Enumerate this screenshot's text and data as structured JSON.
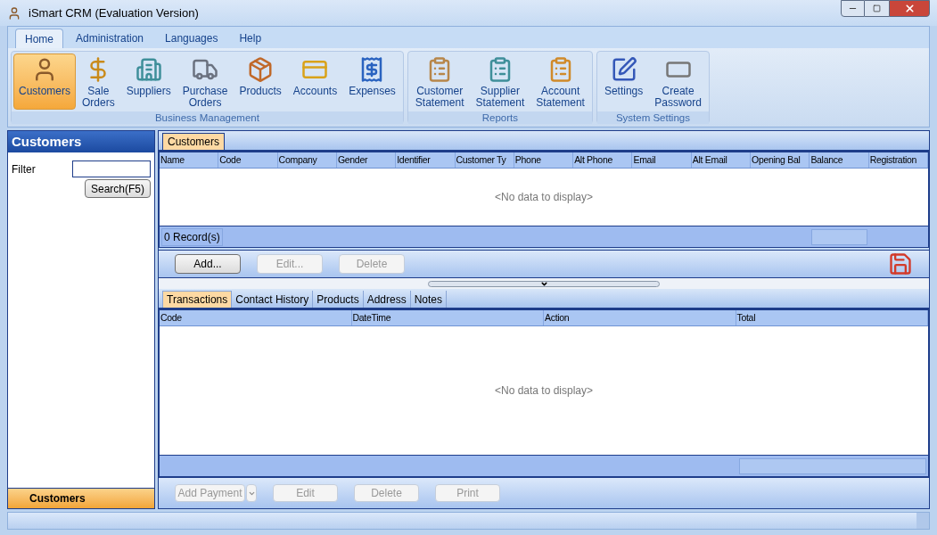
{
  "window": {
    "title": "iSmart CRM (Evaluation Version)"
  },
  "ribbon_tabs": [
    {
      "label": "Home",
      "selected": true
    },
    {
      "label": "Administration",
      "selected": false
    },
    {
      "label": "Languages",
      "selected": false
    },
    {
      "label": "Help",
      "selected": false
    }
  ],
  "ribbon_groups": [
    {
      "label": "Business Management",
      "items": [
        {
          "label": "Customers",
          "selected": true
        },
        {
          "label": "Sale Orders",
          "selected": false
        },
        {
          "label": "Suppliers",
          "selected": false
        },
        {
          "label": "Purchase Orders",
          "selected": false
        },
        {
          "label": "Products",
          "selected": false
        },
        {
          "label": "Accounts",
          "selected": false
        },
        {
          "label": "Expenses",
          "selected": false
        }
      ]
    },
    {
      "label": "Reports",
      "items": [
        {
          "label": "Customer Statement",
          "selected": false
        },
        {
          "label": "Supplier Statement",
          "selected": false
        },
        {
          "label": "Account Statement",
          "selected": false
        }
      ]
    },
    {
      "label": "System Settings",
      "items": [
        {
          "label": "Settings",
          "selected": false
        },
        {
          "label": "Create Password",
          "selected": false
        }
      ]
    }
  ],
  "sidebar": {
    "title": "Customers",
    "filter_label": "Filter",
    "search_button": "Search(F5)",
    "nav": [
      {
        "label": "Customers",
        "selected": true
      }
    ]
  },
  "top_tabs": [
    {
      "label": "Customers",
      "selected": true
    }
  ],
  "customers_table": {
    "columns": [
      "Name",
      "Code",
      "Company",
      "Gender",
      "Identifier",
      "Customer Ty",
      "Phone",
      "Alt Phone",
      "Email",
      "Alt Email",
      "Opening Bal",
      "Balance",
      "Registration"
    ],
    "empty_text": "<No data to display>",
    "footer": "0 Record(s)"
  },
  "customer_buttons": [
    {
      "label": "Add...",
      "disabled": false
    },
    {
      "label": "Edit...",
      "disabled": true
    },
    {
      "label": "Delete",
      "disabled": true
    }
  ],
  "detail_tabs": [
    {
      "label": "Transactions",
      "selected": true
    },
    {
      "label": "Contact History",
      "selected": false
    },
    {
      "label": "Products",
      "selected": false
    },
    {
      "label": "Address",
      "selected": false
    },
    {
      "label": "Notes",
      "selected": false
    }
  ],
  "transactions_table": {
    "columns": [
      "Code",
      "DateTime",
      "Action",
      "Total"
    ],
    "empty_text": "<No data to display>"
  },
  "transaction_buttons": [
    {
      "label": "Add Payment",
      "disabled": true,
      "kind": "split"
    },
    {
      "label": "Edit",
      "disabled": true,
      "kind": "plain"
    },
    {
      "label": "Delete",
      "disabled": true,
      "kind": "plain"
    },
    {
      "label": "Print",
      "disabled": true,
      "kind": "plain"
    }
  ]
}
